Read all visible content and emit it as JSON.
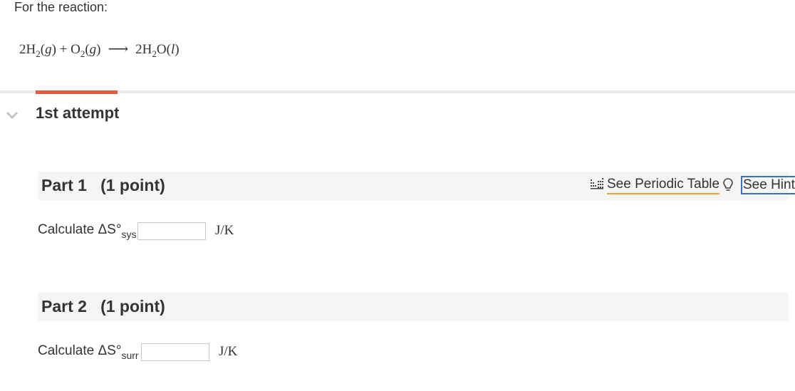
{
  "question": {
    "intro": "For the reaction:",
    "equation": {
      "r1_coef": "2H",
      "r1_sub": "2",
      "r1_state": "g",
      "plus": "+",
      "r2": "O",
      "r2_sub": "2",
      "r2_state": "g",
      "arrow": "⟶",
      "p1_coef": "2H",
      "p1_sub": "2",
      "p1_rest": "O",
      "p1_state": "l"
    }
  },
  "attempt": {
    "label": "1st attempt",
    "chevron_icon": "chevron-down-icon",
    "accent_color": "#e4583e"
  },
  "tools": {
    "periodic_table_label": "See Periodic Table",
    "periodic_table_icon": "periodic-table-icon",
    "hint_label": "See Hint",
    "hint_icon": "lightbulb-icon"
  },
  "parts": [
    {
      "title": "Part 1   (1 point)",
      "prompt": "Calculate ΔS°",
      "subscript": "sys",
      "input_value": "",
      "unit": "J/K"
    },
    {
      "title": "Part 2   (1 point)",
      "prompt": "Calculate ΔS°",
      "subscript": "surr",
      "input_value": "",
      "unit": "J/K"
    }
  ]
}
